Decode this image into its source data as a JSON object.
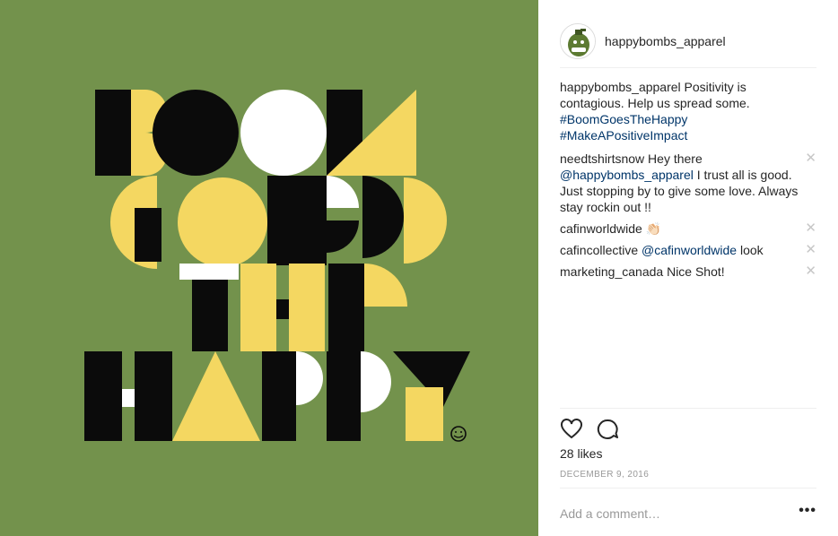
{
  "post": {
    "author": "happybombs_apparel",
    "caption_text": " Positivity is contagious. Help us spread some.",
    "hashtags": [
      "#BoomGoesTheHappy",
      "#MakeAPositiveImpact"
    ],
    "image_colors": {
      "background": "#73924c",
      "yellow": "#f4d761",
      "black": "#0b0b0b",
      "white": "#ffffff"
    }
  },
  "comments": [
    {
      "user": "needtshirtsnow",
      "before": " Hey there ",
      "mention": "@happybombs_apparel",
      "after": " I trust all is good. Just stopping by to give some love. Always stay rockin out !!",
      "delete": "✕"
    },
    {
      "user": "cafinworldwide",
      "before": " 👏🏻",
      "mention": "",
      "after": "",
      "delete": "✕"
    },
    {
      "user": "cafincollective",
      "before": " ",
      "mention": "@cafinworldwide",
      "after": " look",
      "delete": "✕"
    },
    {
      "user": "marketing_canada",
      "before": " Nice Shot!",
      "mention": "",
      "after": "",
      "delete": "✕"
    }
  ],
  "actions": {
    "like_icon": "heart-icon",
    "comment_icon": "comment-icon"
  },
  "likes": "28 likes",
  "date": "DECEMBER 9, 2016",
  "add_comment": {
    "placeholder": "Add a comment…",
    "more": "•••"
  }
}
